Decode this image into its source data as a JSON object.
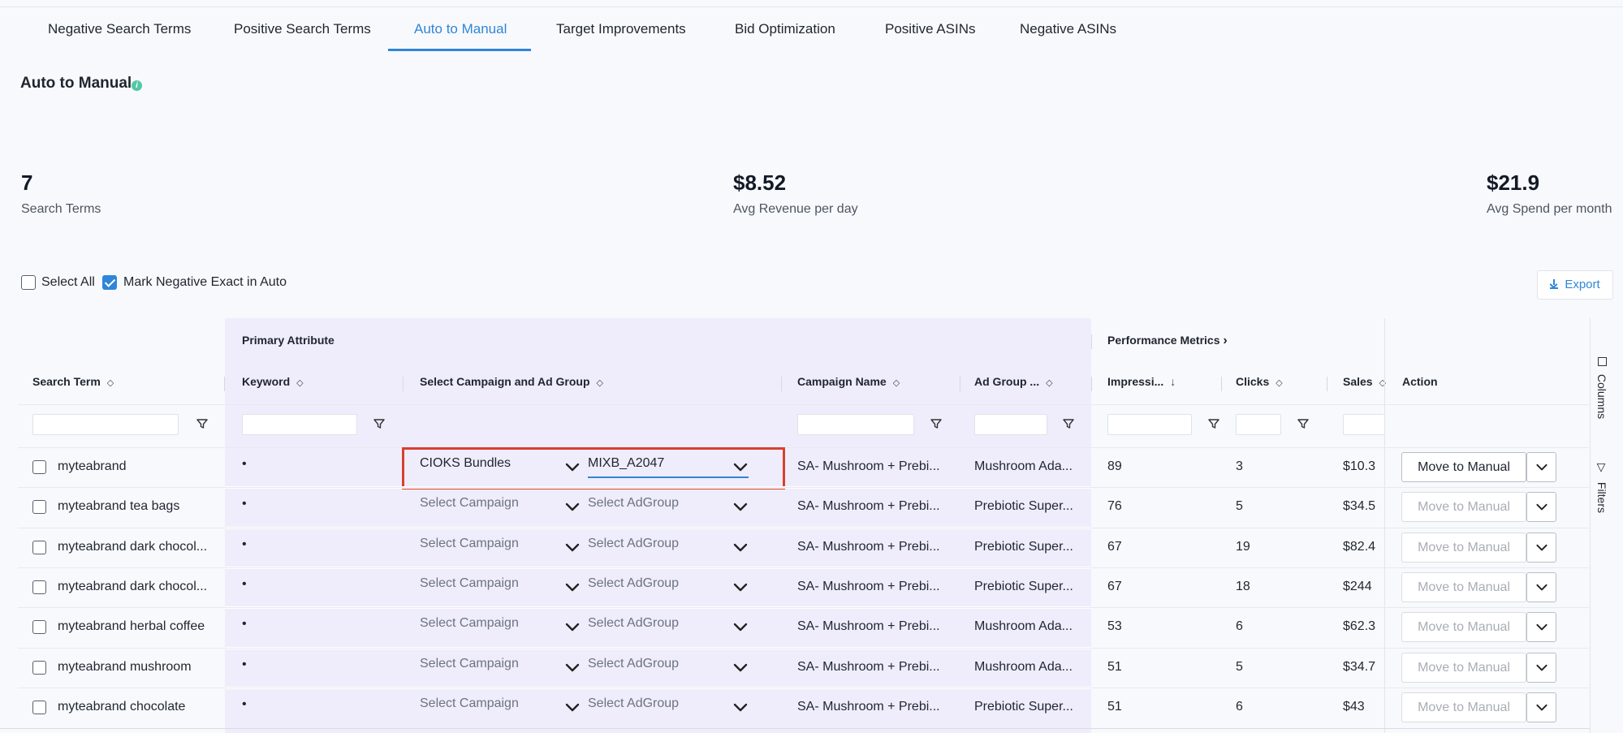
{
  "tabs": [
    "Negative Search Terms",
    "Positive Search Terms",
    "Auto to Manual",
    "Target Improvements",
    "Bid Optimization",
    "Positive ASINs",
    "Negative ASINs"
  ],
  "active_tab": "Auto to Manual",
  "page_title": "Auto to Manual",
  "kpis": [
    {
      "value": "7",
      "label": "Search Terms"
    },
    {
      "value": "$8.52",
      "label": "Avg Revenue per day"
    },
    {
      "value": "$21.9",
      "label": "Avg Spend per month"
    }
  ],
  "toolbar": {
    "select_all_label": "Select All",
    "select_all_checked": false,
    "mark_negative_label": "Mark Negative Exact in Auto",
    "mark_negative_checked": true,
    "export_label": "Export"
  },
  "table": {
    "group_headers": {
      "primary": "Primary Attribute",
      "performance": "Performance Metrics"
    },
    "columns": [
      "Search Term",
      "Keyword",
      "Select Campaign and Ad Group",
      "Campaign Name",
      "Ad Group ...",
      "Impressi...",
      "Clicks",
      "Sales",
      "Action"
    ],
    "rows": [
      {
        "term": "myteabrand",
        "keyword": "•",
        "campaign": "CIOKS Bundles",
        "adgroup": "MIXB_A2047",
        "campaign_name": "SA- Mushroom + Prebi...",
        "adgroup_name": "Mushroom Ada...",
        "impressions": "89",
        "clicks": "3",
        "sales": "$10.3",
        "action": "Move to Manual"
      },
      {
        "term": "myteabrand tea bags",
        "keyword": "•",
        "campaign": "Select Campaign",
        "adgroup": "Select AdGroup",
        "campaign_name": "SA- Mushroom + Prebi...",
        "adgroup_name": "Prebiotic Super...",
        "impressions": "76",
        "clicks": "5",
        "sales": "$34.5",
        "action": "Move to Manual"
      },
      {
        "term": "myteabrand dark chocol...",
        "keyword": "•",
        "campaign": "Select Campaign",
        "adgroup": "Select AdGroup",
        "campaign_name": "SA- Mushroom + Prebi...",
        "adgroup_name": "Prebiotic Super...",
        "impressions": "67",
        "clicks": "19",
        "sales": "$82.4",
        "action": "Move to Manual"
      },
      {
        "term": "myteabrand dark chocol...",
        "keyword": "•",
        "campaign": "Select Campaign",
        "adgroup": "Select AdGroup",
        "campaign_name": "SA- Mushroom + Prebi...",
        "adgroup_name": "Prebiotic Super...",
        "impressions": "67",
        "clicks": "18",
        "sales": "$244",
        "action": "Move to Manual"
      },
      {
        "term": "myteabrand herbal coffee",
        "keyword": "•",
        "campaign": "Select Campaign",
        "adgroup": "Select AdGroup",
        "campaign_name": "SA- Mushroom + Prebi...",
        "adgroup_name": "Mushroom Ada...",
        "impressions": "53",
        "clicks": "6",
        "sales": "$62.3",
        "action": "Move to Manual"
      },
      {
        "term": "myteabrand mushroom",
        "keyword": "•",
        "campaign": "Select Campaign",
        "adgroup": "Select AdGroup",
        "campaign_name": "SA- Mushroom + Prebi...",
        "adgroup_name": "Mushroom Ada...",
        "impressions": "51",
        "clicks": "5",
        "sales": "$34.7",
        "action": "Move to Manual"
      },
      {
        "term": "myteabrand chocolate",
        "keyword": "•",
        "campaign": "Select Campaign",
        "adgroup": "Select AdGroup",
        "campaign_name": "SA- Mushroom + Prebi...",
        "adgroup_name": "Prebiotic Super...",
        "impressions": "51",
        "clicks": "6",
        "sales": "$43",
        "action": "Move to Manual"
      }
    ]
  },
  "side_panel": {
    "columns_label": "Columns",
    "filters_label": "Filters"
  },
  "colors": {
    "accent": "#2f86d8",
    "highlight": "#d9402f",
    "primary_bg": "#efedfb",
    "info": "#52c7a4"
  }
}
